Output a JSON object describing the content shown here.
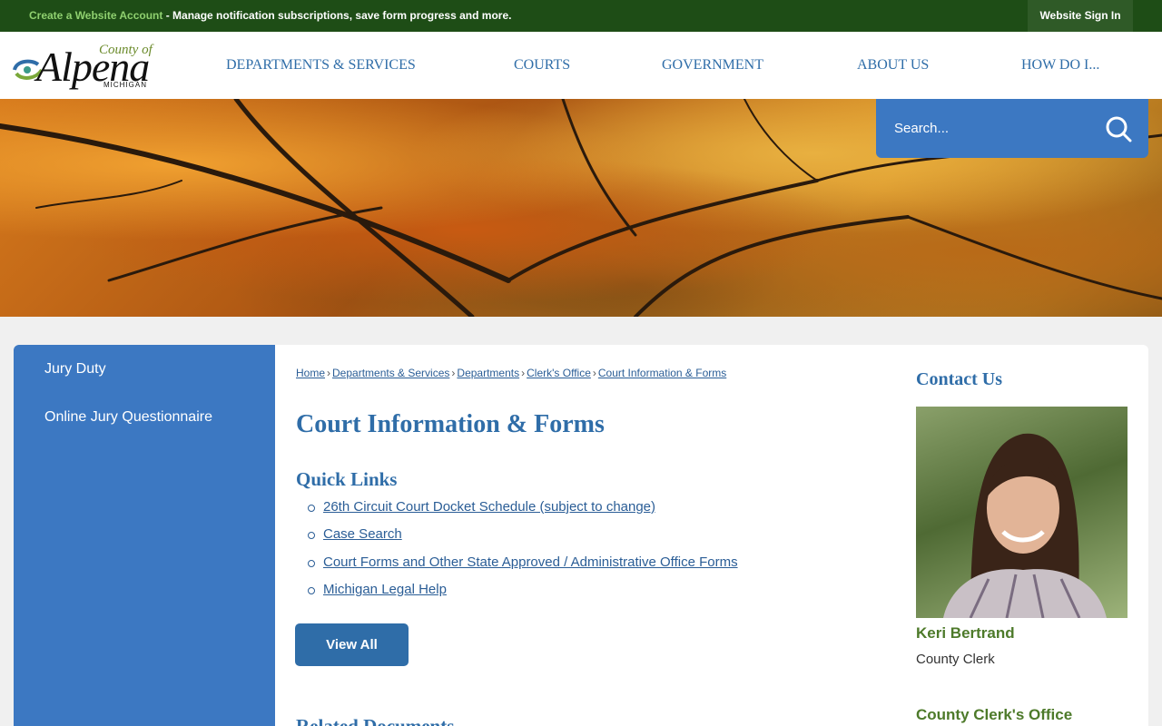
{
  "topbar": {
    "create_account": "Create a Website Account",
    "message": " - Manage notification subscriptions, save form progress and more.",
    "signin": "Website Sign In"
  },
  "logo": {
    "county_of": "County of",
    "name": "Alpena",
    "state": "MICHIGAN"
  },
  "nav": [
    "DEPARTMENTS & SERVICES",
    "COURTS",
    "GOVERNMENT",
    "ABOUT US",
    "HOW DO I..."
  ],
  "search": {
    "placeholder": "Search..."
  },
  "sidebar": {
    "items": [
      {
        "label": "Jury Duty"
      },
      {
        "label": "Online Jury Questionnaire"
      }
    ]
  },
  "breadcrumb": [
    "Home",
    "Departments & Services",
    "Departments",
    "Clerk's Office",
    "Court Information & Forms"
  ],
  "page": {
    "title": "Court Information & Forms",
    "quick_links_heading": "Quick Links",
    "quick_links": [
      "26th Circuit Court Docket Schedule (subject to change)",
      "Case Search",
      "Court Forms and Other State Approved / Administrative Office Forms",
      "Michigan Legal Help"
    ],
    "view_all": "View All",
    "related_heading": "Related Documents"
  },
  "contact": {
    "heading": "Contact Us",
    "name": "Keri Bertrand",
    "title": "County Clerk",
    "office": "County Clerk's Office"
  },
  "colors": {
    "topbar": "#1e4d16",
    "accent_blue": "#3c78c2",
    "link": "#2a5d96",
    "green_text": "#4d7a2a"
  }
}
